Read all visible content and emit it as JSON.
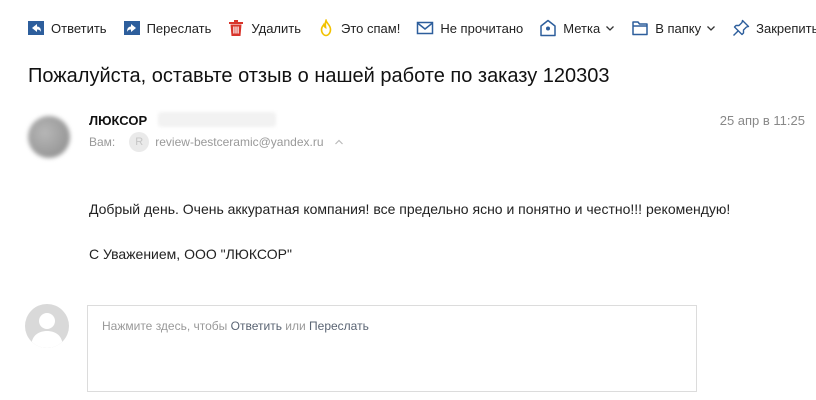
{
  "toolbar": {
    "reply": "Ответить",
    "forward": "Переслать",
    "delete": "Удалить",
    "spam": "Это спам!",
    "unread": "Не прочитано",
    "label": "Метка",
    "folder": "В папку",
    "pin": "Закрепить"
  },
  "message": {
    "subject": "Пожалуйста, оставьте отзыв о нашей работе по заказу 120303",
    "sender_name": "ЛЮКСОР",
    "date": "25 апр в 11:25",
    "to_label": "Вам:",
    "to_avatar_letter": "R",
    "to_email": "review-bestceramic@yandex.ru",
    "body": "Добрый день. Очень аккуратная компания! все предельно ясно и понятно и честно!!! рекомендую!",
    "signature": "С Уважением, ООО \"ЛЮКСОР\""
  },
  "reply_box": {
    "hint_prefix": "Нажмите здесь, чтобы ",
    "reply_link": "Ответить",
    "or": " или ",
    "forward_link": "Переслать"
  },
  "colors": {
    "icon_blue": "#2d5e9c",
    "delete_red": "#d8342b",
    "spam_yellow": "#f2c200"
  }
}
